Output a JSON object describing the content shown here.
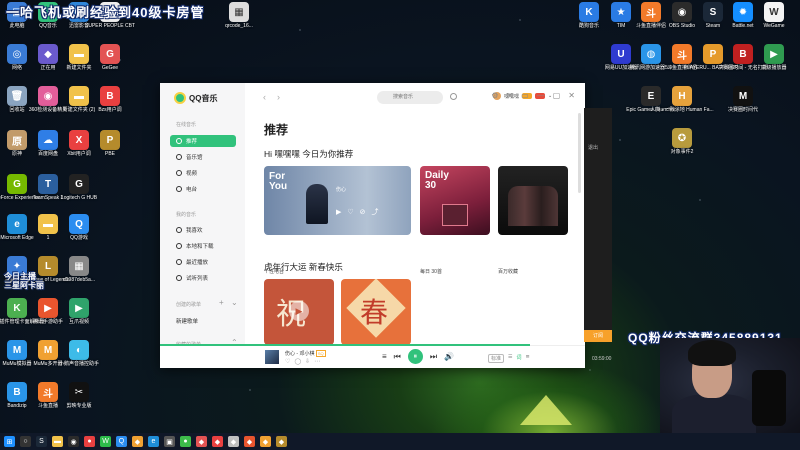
{
  "overlay": {
    "top_banner": "一哈飞机或刷经验到40级卡房管",
    "bottom_right_banner": "QQ粉丝交流群345889131",
    "left_banner": "今日主播\n三星阿卡丽"
  },
  "desktop_icons_left": [
    {
      "label": "此电脑",
      "icon": "computer-icon",
      "color": "#3a7bd5",
      "glyph": "▣"
    },
    {
      "label": "QQ音乐",
      "icon": "qqmusic-icon",
      "color": "#31c27c",
      "glyph": "♪"
    },
    {
      "label": "迅雷影音",
      "icon": "xunlei-icon",
      "color": "#2f86d9",
      "glyph": "▶"
    },
    {
      "label": "SUPER PEOPLE CBT",
      "icon": "game-icon",
      "color": "#eeeeee",
      "glyph": "S"
    },
    {
      "label": "qrcode_16...",
      "icon": "file-icon",
      "color": "#dddddd",
      "glyph": "▦"
    },
    {
      "label": "网络",
      "icon": "network-icon",
      "color": "#3a7bd5",
      "glyph": "◎"
    },
    {
      "label": "正在用",
      "icon": "app-icon",
      "color": "#6a5acd",
      "glyph": "◆"
    },
    {
      "label": "新建文件夹",
      "icon": "folder-icon",
      "color": "#f1c24a",
      "glyph": "▬"
    },
    {
      "label": "GeGee",
      "icon": "app-icon",
      "color": "#e35353",
      "glyph": "G"
    },
    {
      "label": "回收站",
      "icon": "recycle-bin-icon",
      "color": "#8aa4c0",
      "glyph": "🗑"
    },
    {
      "label": "360检测设备精灵",
      "icon": "360-icon",
      "color": "#e25e9a",
      "glyph": "◉"
    },
    {
      "label": "新建文件夹 (2)",
      "icon": "folder-icon",
      "color": "#f1c24a",
      "glyph": "▬"
    },
    {
      "label": "Bzs用户调",
      "icon": "app-icon",
      "color": "#e94040",
      "glyph": "B"
    },
    {
      "label": "原神",
      "icon": "genshin-icon",
      "color": "#c29b6a",
      "glyph": "原"
    },
    {
      "label": "百度网盘",
      "icon": "baidu-icon",
      "color": "#2f7ee6",
      "glyph": "☁"
    },
    {
      "label": "Xbit用户调",
      "icon": "app-icon",
      "color": "#e94040",
      "glyph": "X"
    },
    {
      "label": "PBE",
      "icon": "lol-icon",
      "color": "#b58b2c",
      "glyph": "P"
    },
    {
      "label": "GeForce Experience",
      "icon": "nvidia-icon",
      "color": "#76b900",
      "glyph": "G"
    },
    {
      "label": "TeamSpeak 3",
      "icon": "teamspeak-icon",
      "color": "#2b5f9e",
      "glyph": "T"
    },
    {
      "label": "Logitech G HUB",
      "icon": "logitech-icon",
      "color": "#222222",
      "glyph": "G"
    },
    {
      "label": "Microsoft Edge",
      "icon": "edge-icon",
      "color": "#1f8ed8",
      "glyph": "e"
    },
    {
      "label": "1",
      "icon": "file-icon",
      "color": "#f1c24a",
      "glyph": "▬"
    },
    {
      "label": "QQ游戏",
      "icon": "qqgame-icon",
      "color": "#2b8df0",
      "glyph": "Q"
    },
    {
      "label": "三星阿卡丽",
      "icon": "app-icon",
      "color": "#3a7bd5",
      "glyph": "✦"
    },
    {
      "label": "League of Legends",
      "icon": "lol-icon",
      "color": "#b58b2c",
      "glyph": "L"
    },
    {
      "label": "d1987deb5a...",
      "icon": "file-icon",
      "color": "#888888",
      "glyph": "▦"
    },
    {
      "label": "KSS插件管理卡面解锁器",
      "icon": "app-icon",
      "color": "#4caf50",
      "glyph": "K"
    },
    {
      "label": "腾讯手游助手",
      "icon": "tencent-icon",
      "color": "#e9552e",
      "glyph": "▶"
    },
    {
      "label": "互爪视频",
      "icon": "app-icon",
      "color": "#2fa36b",
      "glyph": "▶"
    },
    {
      "label": "MuMu模拟器",
      "icon": "mumu-icon",
      "color": "#2a95e8",
      "glyph": "M"
    },
    {
      "label": "MuMu多开器",
      "icon": "mumu-icon",
      "color": "#f0a132",
      "glyph": "M"
    },
    {
      "label": "小鹅声音播控助手",
      "icon": "app-icon",
      "color": "#3dbbe8",
      "glyph": "◐"
    },
    {
      "label": "Bandizip",
      "icon": "bandizip-icon",
      "color": "#2a95e8",
      "glyph": "B"
    },
    {
      "label": "斗鱼直播",
      "icon": "douyu-icon",
      "color": "#f27a2a",
      "glyph": "斗"
    },
    {
      "label": "剪映专业版",
      "icon": "jianying-icon",
      "color": "#111111",
      "glyph": "✂"
    }
  ],
  "desktop_icons_right": [
    {
      "label": "酷狗音乐",
      "icon": "kugou-icon",
      "color": "#2a7be4",
      "glyph": "K"
    },
    {
      "label": "TIM",
      "icon": "tim-icon",
      "color": "#2a7be4",
      "glyph": "★"
    },
    {
      "label": "斗鱼直播伴侣",
      "icon": "douyu-icon",
      "color": "#f27a2a",
      "glyph": "斗"
    },
    {
      "label": "OBS Studio",
      "icon": "obs-icon",
      "color": "#2b2b2b",
      "glyph": "◉"
    },
    {
      "label": "Steam",
      "icon": "steam-icon",
      "color": "#1b2838",
      "glyph": "S"
    },
    {
      "label": "Battle.net",
      "icon": "battlenet-icon",
      "color": "#148eff",
      "glyph": "✹"
    },
    {
      "label": "WeGame",
      "icon": "wegame-icon",
      "color": "#f4f4f4",
      "glyph": "W"
    },
    {
      "label": "网易UU加速器",
      "icon": "uu-icon",
      "color": "#2f3bd0",
      "glyph": "U"
    },
    {
      "label": "腾讯网游加速器5.0",
      "icon": "tencent-icon",
      "color": "#2a95e8",
      "glyph": "◍"
    },
    {
      "label": "斗鱼直播伴侣",
      "icon": "douyu-icon",
      "color": "#f27a2a",
      "glyph": "斗"
    },
    {
      "label": "PLAYERU... BATTLEGR...",
      "icon": "pubg-icon",
      "color": "#e59a2b",
      "glyph": "P"
    },
    {
      "label": "决赛圈时间 - 无名打擂",
      "icon": "game-icon",
      "color": "#c02020",
      "glyph": "B"
    },
    {
      "label": "高级播放器",
      "icon": "app-icon",
      "color": "#2f9b50",
      "glyph": "▶"
    },
    {
      "label": "Epic Games Launcher",
      "icon": "epic-icon",
      "color": "#2a2a2a",
      "glyph": "E"
    },
    {
      "label": "人类 - 一败涂地 Human Fa...",
      "icon": "game-icon",
      "color": "#e6a23c",
      "glyph": "H"
    },
    {
      "label": "决赛圈时间代",
      "icon": "game-icon",
      "color": "#111111",
      "glyph": "M"
    },
    {
      "label": "对象事件2",
      "icon": "game-icon",
      "color": "#b89b3d",
      "glyph": "✪"
    }
  ],
  "qqmusic": {
    "logo_text": "QQ音乐",
    "nav_back": "‹",
    "nav_forward": "›",
    "search_placeholder": "搜索音乐",
    "username": "嘿嘿嘿",
    "window_controls": [
      "⚙",
      "✉",
      "▭",
      "—",
      "▢",
      "✕"
    ],
    "sidebar": {
      "group_online": "在线音乐",
      "online_items": [
        {
          "label": "推荐",
          "active": true
        },
        {
          "label": "音乐馆",
          "active": false
        },
        {
          "label": "视频",
          "active": false
        },
        {
          "label": "电台",
          "active": false
        }
      ],
      "group_mine": "我的音乐",
      "mine_items": [
        {
          "label": "我喜欢"
        },
        {
          "label": "本地和下载"
        },
        {
          "label": "最近播放"
        },
        {
          "label": "试听列表"
        }
      ],
      "group_created": "创建的歌单",
      "created_items": [
        {
          "label": "新建歌单"
        }
      ],
      "group_collected": "收藏的歌单"
    },
    "main": {
      "page_title": "推荐",
      "greeting": "Hi 嘿嘿嘿 今日为你推荐",
      "cards": [
        {
          "label": "个性电台",
          "badge": "For You",
          "sub": "伤心"
        },
        {
          "label": "每日 30首",
          "badge": "Daily 30"
        },
        {
          "label": "百万收藏",
          "badge": ""
        }
      ],
      "section2": "虎年行大运 新春快乐",
      "festival_cards": [
        "祝",
        "春"
      ]
    },
    "player": {
      "song": "伤心 - 邓小棋",
      "song_badge": "SQ",
      "actions": [
        "♡",
        "◯",
        "⇩",
        "⋯"
      ],
      "controls": [
        "≡",
        "⏮",
        "⏸",
        "⏭",
        "🔊"
      ],
      "quality": "标准",
      "lyric": "词",
      "mode": "☰",
      "progress_fraction": 0.87
    }
  },
  "right_panel": {
    "exit": "退出",
    "button": "订阅",
    "time": "03:59:00"
  },
  "taskbar": [
    {
      "name": "start-icon",
      "glyph": "⊞",
      "color": "#1e90ff"
    },
    {
      "name": "search-icon",
      "glyph": "○",
      "color": "#333"
    },
    {
      "name": "steam-icon",
      "glyph": "S",
      "color": "#1b2838"
    },
    {
      "name": "folder-icon",
      "glyph": "▬",
      "color": "#f1c24a"
    },
    {
      "name": "obs-icon",
      "glyph": "◉",
      "color": "#2b2b2b"
    },
    {
      "name": "chrome-icon",
      "glyph": "●",
      "color": "#e94040"
    },
    {
      "name": "wechat-icon",
      "glyph": "W",
      "color": "#2dbb4a"
    },
    {
      "name": "qq-icon",
      "glyph": "Q",
      "color": "#2b8df0"
    },
    {
      "name": "app-icon",
      "glyph": "◆",
      "color": "#f0a132"
    },
    {
      "name": "edge-icon",
      "glyph": "e",
      "color": "#1f8ed8"
    },
    {
      "name": "game-icon",
      "glyph": "▣",
      "color": "#555"
    },
    {
      "name": "chrome-icon",
      "glyph": "●",
      "color": "#3dbb4a"
    },
    {
      "name": "app-icon",
      "glyph": "◆",
      "color": "#e35353"
    },
    {
      "name": "app-icon",
      "glyph": "◆",
      "color": "#e94040"
    },
    {
      "name": "app-icon",
      "glyph": "◆",
      "color": "#c0c0c0"
    },
    {
      "name": "app-icon",
      "glyph": "◆",
      "color": "#e9552e"
    },
    {
      "name": "app-icon",
      "glyph": "◆",
      "color": "#f0a132"
    },
    {
      "name": "app-icon",
      "glyph": "◆",
      "color": "#b58b2c"
    }
  ]
}
